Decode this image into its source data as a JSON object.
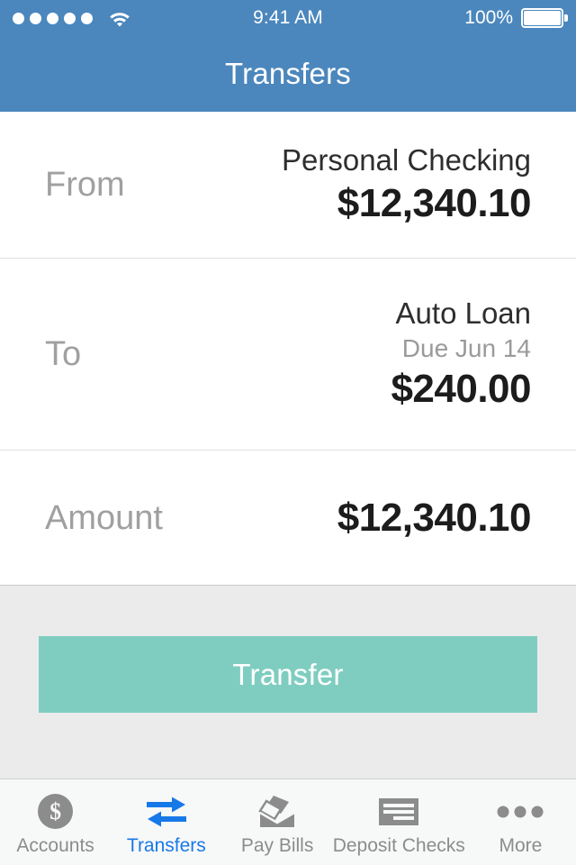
{
  "statusbar": {
    "signal_icon": "signal-dots-icon",
    "signal_dots": 5,
    "wifi_icon": "wifi-icon",
    "time": "9:41 AM",
    "battery_percent": "100%",
    "battery_icon": "battery-full-icon"
  },
  "header": {
    "title": "Transfers",
    "background_color": "#4b87bd"
  },
  "form": {
    "rows": [
      {
        "label": "From",
        "name": "Personal Checking",
        "sub": "",
        "amount": "$12,340.10"
      },
      {
        "label": "To",
        "name": "Auto Loan",
        "sub": "Due Jun 14",
        "amount": "$240.00"
      },
      {
        "label": "Amount",
        "name": "",
        "sub": "",
        "amount": "$12,340.10"
      }
    ]
  },
  "action": {
    "transfer_label": "Transfer",
    "button_color": "#7fcdc0",
    "background_color": "#ebebeb"
  },
  "tabbar": {
    "active_color": "#1779e8",
    "inactive_color": "#8c8c8c",
    "tabs": [
      {
        "label": "Accounts",
        "icon": "dollar-circle-icon",
        "active": false
      },
      {
        "label": "Transfers",
        "icon": "transfer-arrows-icon",
        "active": true
      },
      {
        "label": "Pay Bills",
        "icon": "envelope-bills-icon",
        "active": false
      },
      {
        "label": "Deposit Checks",
        "icon": "check-icon",
        "active": false
      },
      {
        "label": "More",
        "icon": "ellipsis-icon",
        "active": false
      }
    ]
  }
}
